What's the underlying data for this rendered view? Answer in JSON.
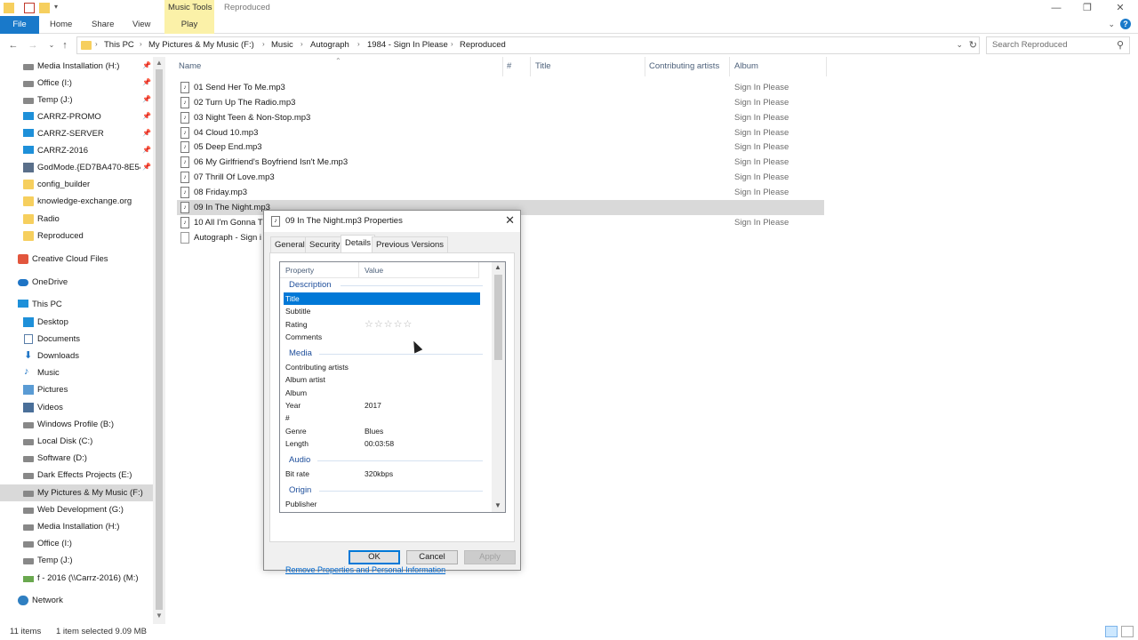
{
  "window": {
    "contextual_tab": "Music Tools",
    "title": "Reproduced"
  },
  "ribbon": {
    "tabs": [
      "File",
      "Home",
      "Share",
      "View",
      "Play"
    ],
    "help": "?"
  },
  "address": {
    "breadcrumbs": [
      "This PC",
      "My Pictures & My Music (F:)",
      "Music",
      "Autograph",
      "1984 - Sign In Please",
      "Reproduced"
    ],
    "search_placeholder": "Search Reproduced"
  },
  "nav": {
    "items": [
      {
        "label": "Media Installation (H:)",
        "icon": "drive-icon",
        "pinned": true
      },
      {
        "label": "Office (I:)",
        "icon": "drive-icon",
        "pinned": true
      },
      {
        "label": "Temp (J:)",
        "icon": "drive-icon",
        "pinned": true
      },
      {
        "label": "CARRZ-PROMO",
        "icon": "computer-icon",
        "pinned": true
      },
      {
        "label": "CARRZ-SERVER",
        "icon": "computer-icon",
        "pinned": true
      },
      {
        "label": "CARRZ-2016",
        "icon": "computer-icon",
        "pinned": true
      },
      {
        "label": "GodMode.{ED7BA470-8E54-",
        "icon": "control-panel-icon",
        "pinned": true
      },
      {
        "label": "config_builder",
        "icon": "folder-icon",
        "pinned": false
      },
      {
        "label": "knowledge-exchange.org",
        "icon": "folder-icon",
        "pinned": false
      },
      {
        "label": "Radio",
        "icon": "folder-icon",
        "pinned": false
      },
      {
        "label": "Reproduced",
        "icon": "folder-icon",
        "pinned": false
      },
      {
        "label": "Creative Cloud Files",
        "icon": "creative-cloud-icon",
        "pinned": false
      },
      {
        "label": "OneDrive",
        "icon": "onedrive-icon",
        "pinned": false
      },
      {
        "label": "This PC",
        "icon": "computer-icon",
        "pinned": false
      },
      {
        "label": "Desktop",
        "icon": "desktop-icon",
        "pinned": false
      },
      {
        "label": "Documents",
        "icon": "documents-icon",
        "pinned": false
      },
      {
        "label": "Downloads",
        "icon": "downloads-icon",
        "pinned": false
      },
      {
        "label": "Music",
        "icon": "music-icon",
        "pinned": false
      },
      {
        "label": "Pictures",
        "icon": "pictures-icon",
        "pinned": false
      },
      {
        "label": "Videos",
        "icon": "videos-icon",
        "pinned": false
      },
      {
        "label": "Windows Profile (B:)",
        "icon": "drive-icon",
        "pinned": false
      },
      {
        "label": "Local Disk (C:)",
        "icon": "drive-icon",
        "pinned": false
      },
      {
        "label": "Software (D:)",
        "icon": "drive-icon",
        "pinned": false
      },
      {
        "label": "Dark Effects Projects (E:)",
        "icon": "drive-icon",
        "pinned": false
      },
      {
        "label": "My Pictures & My Music (F:)",
        "icon": "drive-icon",
        "pinned": false,
        "selected": true
      },
      {
        "label": "Web Development (G:)",
        "icon": "drive-icon",
        "pinned": false
      },
      {
        "label": "Media Installation (H:)",
        "icon": "drive-icon",
        "pinned": false
      },
      {
        "label": "Office (I:)",
        "icon": "drive-icon",
        "pinned": false
      },
      {
        "label": "Temp (J:)",
        "icon": "drive-icon",
        "pinned": false
      },
      {
        "label": "f - 2016 (\\\\Carrz-2016) (M:)",
        "icon": "network-drive-icon",
        "pinned": false
      },
      {
        "label": "Network",
        "icon": "network-icon",
        "pinned": false
      }
    ]
  },
  "columns": [
    "Name",
    "#",
    "Title",
    "Contributing artists",
    "Album"
  ],
  "files": [
    {
      "name": "01 Send Her To Me.mp3",
      "album": "Sign In Please"
    },
    {
      "name": "02 Turn Up The Radio.mp3",
      "album": "Sign In Please"
    },
    {
      "name": "03 Night Teen & Non-Stop.mp3",
      "album": "Sign In Please"
    },
    {
      "name": "04 Cloud 10.mp3",
      "album": "Sign In Please"
    },
    {
      "name": "05 Deep End.mp3",
      "album": "Sign In Please"
    },
    {
      "name": "06 My Girlfriend's Boyfriend Isn't Me.mp3",
      "album": "Sign In Please"
    },
    {
      "name": "07 Thrill Of Love.mp3",
      "album": "Sign In Please"
    },
    {
      "name": "08 Friday.mp3",
      "album": "Sign In Please"
    },
    {
      "name": "09 In The Night.mp3",
      "album": "",
      "selected": true
    },
    {
      "name": "10 All I'm Gonna T",
      "album": "Sign In Please"
    },
    {
      "name": "Autograph - Sign i",
      "album": ""
    }
  ],
  "status": {
    "count": "11 items",
    "selection": "1 item selected  9.09 MB"
  },
  "dialog": {
    "title": "09 In The Night.mp3 Properties",
    "tabs": [
      "General",
      "Security",
      "Details",
      "Previous Versions"
    ],
    "active_tab": "Details",
    "col_property": "Property",
    "col_value": "Value",
    "groups": {
      "description": "Description",
      "media": "Media",
      "audio": "Audio",
      "origin": "Origin"
    },
    "rows": {
      "title": {
        "name": "Title",
        "value": ""
      },
      "subtitle": {
        "name": "Subtitle",
        "value": ""
      },
      "rating": {
        "name": "Rating",
        "value": "☆☆☆☆☆"
      },
      "comments": {
        "name": "Comments",
        "value": ""
      },
      "contributing": {
        "name": "Contributing artists",
        "value": ""
      },
      "album_artist": {
        "name": "Album artist",
        "value": ""
      },
      "album": {
        "name": "Album",
        "value": ""
      },
      "year": {
        "name": "Year",
        "value": "2017"
      },
      "number": {
        "name": "#",
        "value": ""
      },
      "genre": {
        "name": "Genre",
        "value": "Blues"
      },
      "length": {
        "name": "Length",
        "value": "00:03:58"
      },
      "bitrate": {
        "name": "Bit rate",
        "value": "320kbps"
      },
      "publisher": {
        "name": "Publisher",
        "value": ""
      }
    },
    "remove_link": "Remove Properties and Personal Information",
    "buttons": {
      "ok": "OK",
      "cancel": "Cancel",
      "apply": "Apply"
    }
  },
  "colors": {
    "accent": "#0078d7",
    "file_tab": "#1979ca",
    "contextual_tab": "#fbf1a8",
    "selection_gray": "#d9d9d9"
  }
}
